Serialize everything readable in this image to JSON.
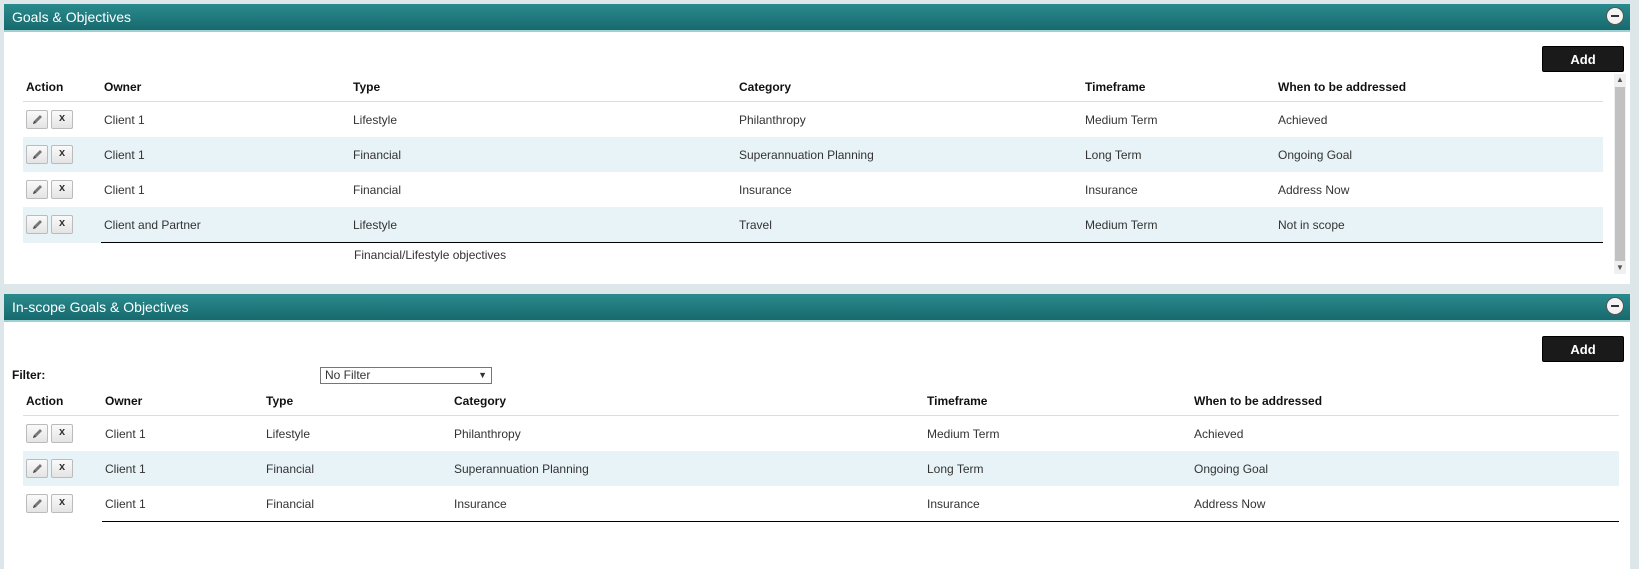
{
  "goals": {
    "title": "Goals & Objectives",
    "add_label": "Add",
    "headers": [
      "Action",
      "Owner",
      "Type",
      "Category",
      "Timeframe",
      "When to be addressed"
    ],
    "rows": [
      {
        "owner": "Client 1",
        "type": "Lifestyle",
        "category": "Philanthropy",
        "timeframe": "Medium Term",
        "when": "Achieved"
      },
      {
        "owner": "Client 1",
        "type": "Financial",
        "category": "Superannuation Planning",
        "timeframe": "Long Term",
        "when": "Ongoing Goal"
      },
      {
        "owner": "Client 1",
        "type": "Financial",
        "category": "Insurance",
        "timeframe": "Insurance",
        "when": "Address Now"
      },
      {
        "owner": "Client and Partner",
        "type": "Lifestyle",
        "category": "Travel",
        "timeframe": "Medium Term",
        "when": "Not in scope"
      }
    ],
    "footer_note": "Financial/Lifestyle objectives"
  },
  "inscope": {
    "title": "In-scope Goals & Objectives",
    "add_label": "Add",
    "filter_label": "Filter:",
    "filter_value": "No Filter",
    "headers": [
      "Action",
      "Owner",
      "Type",
      "Category",
      "Timeframe",
      "When to be addressed"
    ],
    "rows": [
      {
        "owner": "Client 1",
        "type": "Lifestyle",
        "category": "Philanthropy",
        "timeframe": "Medium Term",
        "when": "Achieved"
      },
      {
        "owner": "Client 1",
        "type": "Financial",
        "category": "Superannuation Planning",
        "timeframe": "Long Term",
        "when": "Ongoing Goal"
      },
      {
        "owner": "Client 1",
        "type": "Financial",
        "category": "Insurance",
        "timeframe": "Insurance",
        "when": "Address Now"
      }
    ]
  },
  "icons": {
    "edit": "pencil-icon",
    "delete": "x-icon",
    "collapse": "minus-icon"
  }
}
